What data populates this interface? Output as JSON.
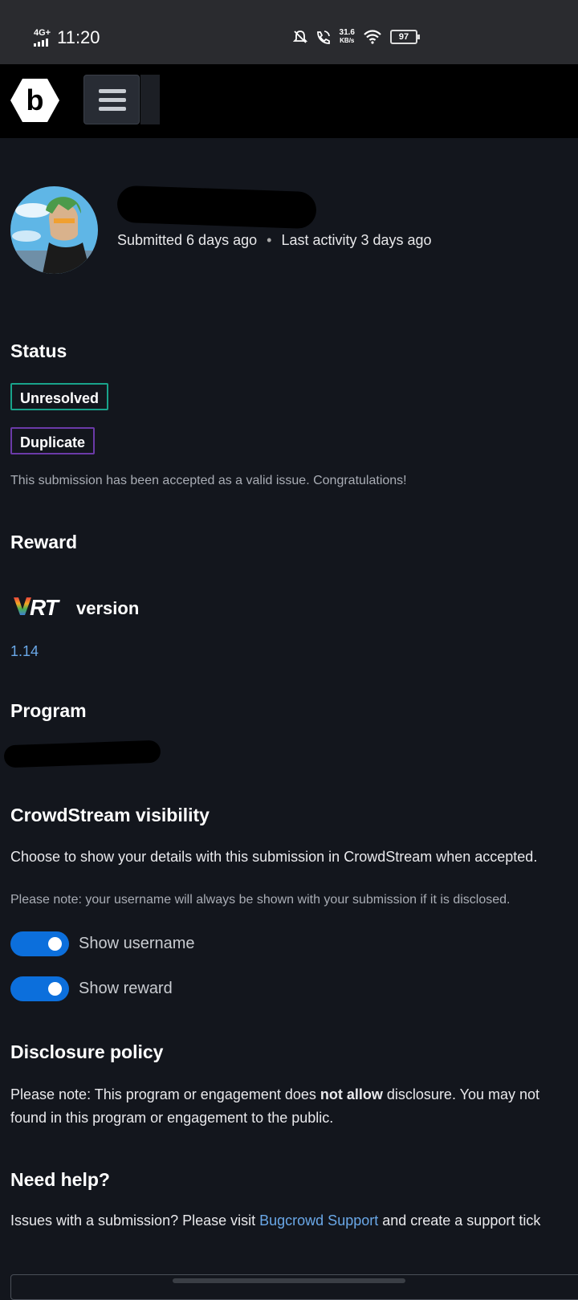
{
  "status_bar": {
    "network": "4G+",
    "time": "11:20",
    "speed_value": "31.6",
    "speed_unit": "KB/s",
    "battery": "97"
  },
  "header": {
    "logo_letter": "b"
  },
  "submission": {
    "submitted": "Submitted 6 days ago",
    "separator": "•",
    "last_activity": "Last activity 3 days ago"
  },
  "status_section": {
    "heading": "Status",
    "badges": [
      {
        "label": "Unresolved",
        "color": "#19a38b"
      },
      {
        "label": "Duplicate",
        "color": "#6b3aa8"
      }
    ],
    "note": "This submission has been accepted as a valid issue. Congratulations!"
  },
  "reward_section": {
    "heading": "Reward"
  },
  "vrt": {
    "logo": "VRT",
    "word": "version",
    "version": "1.14"
  },
  "program_section": {
    "heading": "Program"
  },
  "crowdstream": {
    "heading": "CrowdStream visibility",
    "description": "Choose to show your details with this submission in CrowdStream when accepted.",
    "note": "Please note: your username will always be shown with your submission if it is disclosed.",
    "toggles": [
      {
        "label": "Show username",
        "on": true
      },
      {
        "label": "Show reward",
        "on": true
      }
    ]
  },
  "disclosure": {
    "heading": "Disclosure policy",
    "line1_prefix": "Please note: This program or engagement does ",
    "line1_bold": "not allow",
    "line1_suffix": " disclosure. You may not",
    "line2": "found in this program or engagement to the public."
  },
  "help": {
    "heading": "Need help?",
    "prefix": "Issues with a submission? Please visit ",
    "link": "Bugcrowd Support",
    "suffix": " and create a support tick"
  },
  "colors": {
    "background": "#13161d",
    "accent_link": "#6aa8e8",
    "toggle_on": "#0c6fdc"
  }
}
